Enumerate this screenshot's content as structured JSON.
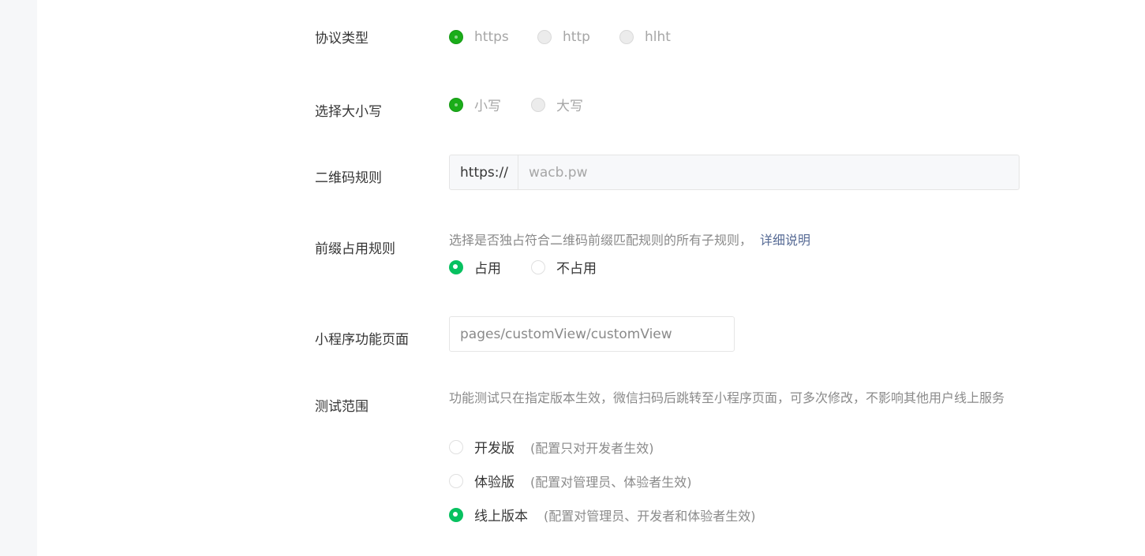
{
  "form": {
    "protocol": {
      "label": "协议类型",
      "options": [
        {
          "text": "https",
          "selected": true
        },
        {
          "text": "http",
          "selected": false
        },
        {
          "text": "hlht",
          "selected": false
        }
      ]
    },
    "case": {
      "label": "选择大小写",
      "options": [
        {
          "text": "小写",
          "selected": true
        },
        {
          "text": "大写",
          "selected": false
        }
      ]
    },
    "qr_rule": {
      "label": "二维码规则",
      "prefix": "https://",
      "value": "wacb.pw"
    },
    "prefix_occupy": {
      "label": "前缀占用规则",
      "description": "选择是否独占符合二维码前缀匹配规则的所有子规则，",
      "link": "详细说明",
      "options": [
        {
          "text": "占用",
          "selected": true
        },
        {
          "text": "不占用",
          "selected": false
        }
      ]
    },
    "miniprogram_page": {
      "label": "小程序功能页面",
      "value": "pages/customView/customView"
    },
    "test_scope": {
      "label": "测试范围",
      "description": "功能测试只在指定版本生效，微信扫码后跳转至小程序页面，可多次修改，不影响其他用户线上服务",
      "options": [
        {
          "text": "开发版",
          "note": "(配置只对开发者生效)",
          "selected": false
        },
        {
          "text": "体验版",
          "note": "(配置对管理员、体验者生效)",
          "selected": false
        },
        {
          "text": "线上版本",
          "note": "(配置对管理员、开发者和体验者生效)",
          "selected": true
        }
      ]
    }
  },
  "colors": {
    "accent_green": "#07c160",
    "disabled_green": "#1aad19",
    "link": "#576b95",
    "muted_text": "#8a8a8a"
  }
}
